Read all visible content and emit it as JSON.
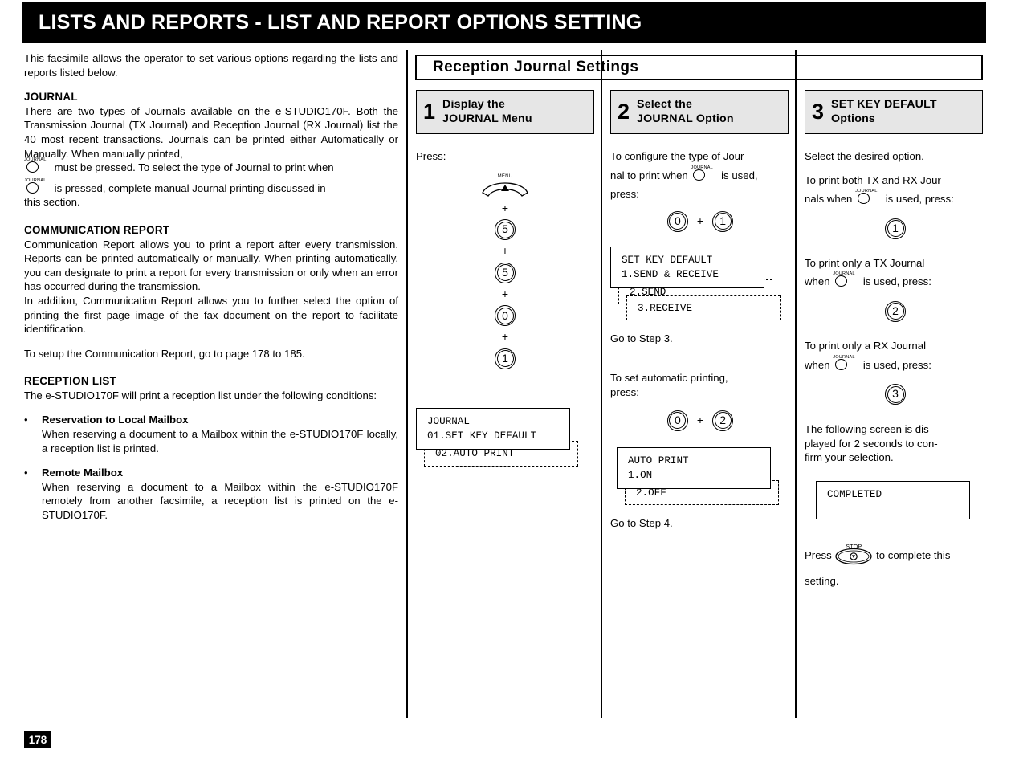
{
  "header": {
    "title": "LISTS AND REPORTS  - LIST AND REPORT OPTIONS SETTING"
  },
  "page_number": "178",
  "left_column": {
    "intro": "This facsimile allows the operator to set various options regarding the lists and reports listed below.",
    "journal": {
      "heading": "JOURNAL",
      "text_1": "There are two types of Journals available on the e-STUDIO170F. Both the Transmission Journal (TX Journal) and Reception Journal (RX Journal) list the 40 most recent transactions. Journals can be printed either Automatically or Manually. When manually printed,",
      "text_2": "must be pressed. To select the type of Journal to print when",
      "text_3": "is pressed, complete manual Journal printing discussed in",
      "text_4": "this  section."
    },
    "communication_report": {
      "heading": "COMMUNICATION  REPORT",
      "text_1": "Communication Report allows you to print a report after every transmission. Reports can be printed automatically or manually. When printing automatically, you can designate to print a report for every transmission or only when an error has occurred during the transmission.",
      "text_2": "In addition, Communication Report allows you to further select the option of printing the first page image of the fax document on the report to facilitate identification.",
      "text_3": "To setup the Communication Report, go to page 178 to 185."
    },
    "reception_list": {
      "heading": "RECEPTION  LIST",
      "text_1": "The e-STUDIO170F will print a reception list under the following conditions:",
      "bullets": [
        {
          "marker": "•",
          "title": "Reservation to Local Mailbox",
          "body": "When reserving a document to a Mailbox within the e-STUDIO170F locally, a reception list is printed."
        },
        {
          "marker": "•",
          "title": "Remote  Mailbox",
          "body": "When reserving a document to a Mailbox within the e-STUDIO170F remotely from another facsimile, a reception list is printed on the e-STUDIO170F."
        }
      ]
    }
  },
  "panel": {
    "title": "Reception  Journal  Settings",
    "steps": [
      {
        "num": "1",
        "label_line1": "Display the",
        "label_line2": "JOURNAL  Menu"
      },
      {
        "num": "2",
        "label_line1": "Select the",
        "label_line2": "JOURNAL  Option"
      },
      {
        "num": "3",
        "label_line1": "SET KEY DEFAULT",
        "label_line2": "Options"
      }
    ]
  },
  "step1": {
    "press_label": "Press:",
    "keys": [
      {
        "type": "menu",
        "label": "MENU"
      },
      {
        "type": "plus",
        "label": "+"
      },
      {
        "type": "num",
        "label": "5"
      },
      {
        "type": "plus",
        "label": "+"
      },
      {
        "type": "num",
        "label": "5"
      },
      {
        "type": "plus",
        "label": "+"
      },
      {
        "type": "num",
        "label": "0"
      },
      {
        "type": "plus",
        "label": "+"
      },
      {
        "type": "num",
        "label": "1"
      }
    ],
    "lcd": {
      "line1": "JOURNAL",
      "line2": "01.SET KEY DEFAULT",
      "ghost1": "02.AUTO PRINT"
    }
  },
  "step2": {
    "text_1a": "To configure the type of Jour-",
    "text_1b": "nal to print when",
    "text_1c": "is used,",
    "text_1d": "press:",
    "keys_1": {
      "a": "0",
      "plus": "+",
      "b": "1"
    },
    "lcd_1": {
      "line1": "SET KEY DEFAULT",
      "line2": "1.SEND & RECEIVE",
      "ghost1": "2.SEND",
      "ghost2": "3.RECEIVE"
    },
    "goto_1": "Go to Step 3.",
    "text_2a": "To set automatic printing,",
    "text_2b": "press:",
    "keys_2": {
      "a": "0",
      "plus": "+",
      "b": "2"
    },
    "lcd_2": {
      "line1": "AUTO PRINT",
      "line2": "1.ON",
      "ghost1": "2.OFF"
    },
    "goto_2": "Go to Step 4."
  },
  "step3": {
    "intro": "Select the desired option.",
    "opt1_a": "To print both TX and RX Jour-",
    "opt1_b": "nals when",
    "opt1_c": "is used, press:",
    "opt1_key": "1",
    "opt2_a": "To print only a TX Journal",
    "opt2_b": "when",
    "opt2_c": "is used, press:",
    "opt2_key": "2",
    "opt3_a": "To print only a RX Journal",
    "opt3_b": "when",
    "opt3_c": "is used, press:",
    "opt3_key": "3",
    "confirm_text": "The following screen is dis-played for 2 seconds to con-firm your selection.",
    "confirm_line1": "The following screen is dis-",
    "confirm_line2": "played for 2 seconds to con-",
    "confirm_line3": "firm  your  selection.",
    "lcd": {
      "line1": "COMPLETED"
    },
    "stop_a": "Press",
    "stop_label": "STOP",
    "stop_b": "to complete this",
    "stop_c": "setting."
  },
  "icons": {
    "journal_key_label": "JOURNAL",
    "menu_key_label": "MENU",
    "stop_key_label": "STOP"
  },
  "colors": {
    "header_bg": "#000000",
    "header_fg": "#ffffff",
    "step_head_bg": "#e6e6e6",
    "page_bg": "#ffffff",
    "rule": "#000000"
  }
}
